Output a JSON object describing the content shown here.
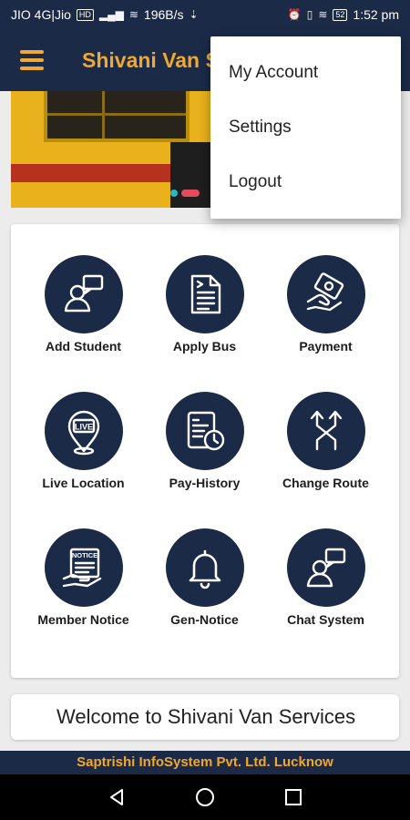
{
  "status_bar": {
    "carrier": "JIO 4G|Jio",
    "network_badge": "HD",
    "speed": "196B/s",
    "battery": "52",
    "time": "1:52 pm"
  },
  "app_bar": {
    "title": "Shivani Van Services",
    "menu_icon": "hamburger-icon"
  },
  "dropdown_menu": {
    "items": [
      {
        "label": "My Account"
      },
      {
        "label": "Settings"
      },
      {
        "label": "Logout"
      }
    ]
  },
  "grid": {
    "tiles": [
      {
        "label": "Add Student",
        "icon": "add-student-icon"
      },
      {
        "label": "Apply Bus",
        "icon": "document-icon"
      },
      {
        "label": "Payment",
        "icon": "payment-icon"
      },
      {
        "label": "Live Location",
        "icon": "live-location-icon"
      },
      {
        "label": "Pay-History",
        "icon": "pay-history-icon"
      },
      {
        "label": "Change Route",
        "icon": "change-route-icon"
      },
      {
        "label": "Member Notice",
        "icon": "notice-icon"
      },
      {
        "label": "Gen-Notice",
        "icon": "bell-icon"
      },
      {
        "label": "Chat System",
        "icon": "chat-icon"
      }
    ]
  },
  "welcome": {
    "text": "Welcome to Shivani Van Services"
  },
  "footer": {
    "text": "Saptrishi InfoSystem Pvt. Ltd. Lucknow"
  },
  "colors": {
    "primary": "#1b2a47",
    "accent": "#f2a72e",
    "card": "#ffffff",
    "background": "#ececec"
  }
}
